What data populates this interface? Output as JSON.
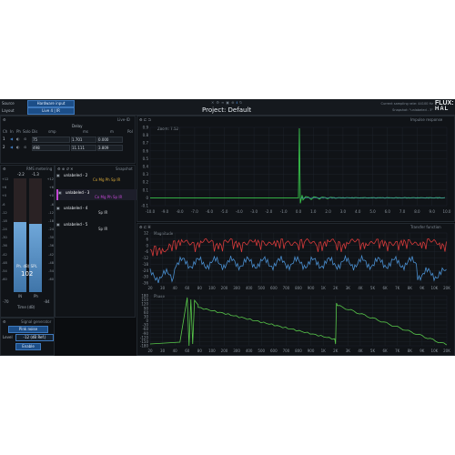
{
  "top": {
    "source_label": "Source",
    "source_value": "Hardware input",
    "layout_label": "Layout",
    "layout_value": "Live 4 | IR",
    "project_title": "Project: Default",
    "sampling_rate": "Current sampling rate: 44100 Hz",
    "snapshot": "Snapshot: \"unlabeled - 3\"",
    "logo_top": "FLUX:",
    "logo_bottom": "HAL"
  },
  "delay": {
    "title": "Delay",
    "panel_id": "Live-ID",
    "col_headers": [
      "Ch",
      "In",
      "Ph",
      "Solo",
      "Dis",
      "smp",
      "ms",
      "m",
      "Pol"
    ],
    "rows": [
      {
        "ch": "1",
        "smp": "75",
        "ms": "1.701",
        "m": "0.000"
      },
      {
        "ch": "2",
        "smp": "498",
        "ms": "11.111",
        "m": "3.809"
      }
    ]
  },
  "meter": {
    "title": "RMS metering",
    "top_values": [
      "-2.2",
      "-1.3"
    ],
    "scale": [
      "+12",
      "+6",
      "+0",
      "-6",
      "-12",
      "-18",
      "-24",
      "-30",
      "-36",
      "-42",
      "-48",
      "-54",
      "-60"
    ],
    "spl_label": "Ph. dB( SPL",
    "spl_value": "102",
    "bottom_labels": [
      "IN",
      "Ph"
    ],
    "scale_end": [
      "-70",
      "-84"
    ],
    "time_label": "Time (dB)",
    "level_left": 0.62,
    "level_right": 0.6
  },
  "snapshots": {
    "title": "Snapshot",
    "items": [
      {
        "name": "unlabeled - 2",
        "flags": "Co Mg Ph Sp IR",
        "color": "#d6a83a"
      },
      {
        "name": "unlabeled - 3",
        "flags": "Co Mg Ph Sp IR",
        "color": "#c447d6"
      },
      {
        "name": "unlabeled - 4",
        "flags": "Sp IR",
        "color": "#c9ccd0"
      },
      {
        "name": "unlabeled - 5",
        "flags": "Sp IR",
        "color": "#c9ccd0"
      }
    ]
  },
  "siggen": {
    "title": "Signal generator",
    "mode": "Pink noise",
    "level_label": "Level",
    "level_value": "-12 (dB Ref.)",
    "enable": "Enable"
  },
  "impulse": {
    "title": "Impulse response",
    "zoom": "Zoom: 7.52",
    "y_ticks": [
      "0.9",
      "0.8",
      "0.7",
      "0.6",
      "0.5",
      "0.4",
      "0.3",
      "0.2",
      "0.1",
      "0",
      "-0.1"
    ],
    "x_ticks": [
      "-10.0",
      "-9.0",
      "-8.0",
      "-7.0",
      "-6.0",
      "-5.0",
      "-4.0",
      "-3.0",
      "-2.0",
      "-1.0",
      "0.0",
      "1.0",
      "2.0",
      "3.0",
      "4.0",
      "5.0",
      "6.0",
      "7.0",
      "8.0",
      "9.0",
      "10.0"
    ]
  },
  "transfer": {
    "title": "Transfer function",
    "magnitude_label": "Magnitude",
    "phase_label": "Phase",
    "mag_y_ticks": [
      "12",
      "6",
      "0",
      "-6",
      "-12",
      "-18",
      "-24",
      "-30",
      "-36"
    ],
    "phase_y_ticks": [
      "180",
      "150",
      "120",
      "90",
      "60",
      "30",
      "0",
      "-30",
      "-60",
      "-90",
      "-120",
      "-150",
      "-180"
    ],
    "x_ticks": [
      "20",
      "30",
      "40",
      "60",
      "80",
      "100",
      "200",
      "300",
      "400",
      "500",
      "600",
      "700",
      "800",
      "900",
      "1K",
      "2K",
      "3K",
      "4K",
      "5K",
      "6K",
      "7K",
      "8K",
      "9K",
      "10K",
      "20K"
    ]
  },
  "colors": {
    "accent_blue": "#3e79bd",
    "impulse_green": "#38c34a",
    "magnitude_red": "#d63a3a",
    "magnitude_blue": "#4a8fd0",
    "phase_green": "#58c84a"
  },
  "icons": [
    "settings-icon",
    "link-icon",
    "lock-icon",
    "zoom-icon",
    "close-icon"
  ]
}
